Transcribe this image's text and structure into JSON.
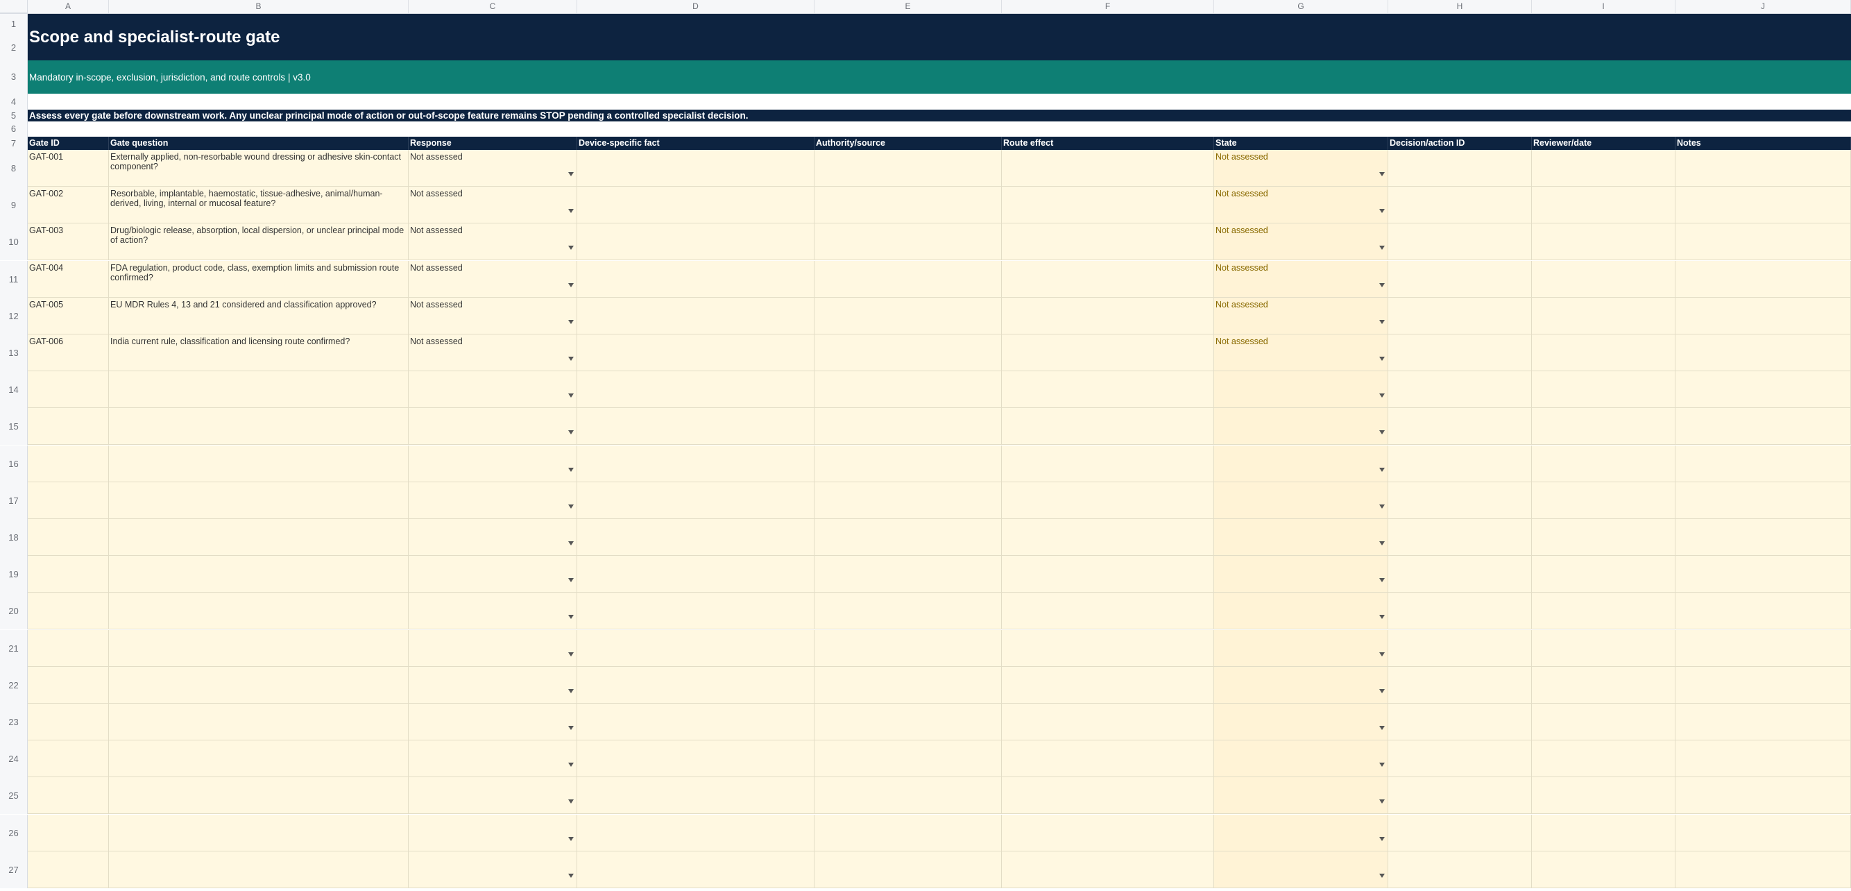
{
  "columns": [
    "A",
    "B",
    "C",
    "D",
    "E",
    "F",
    "G",
    "H",
    "I",
    "J"
  ],
  "row_numbers": [
    "1",
    "2",
    "3",
    "4",
    "5",
    "6",
    "7",
    "8",
    "9",
    "10",
    "11",
    "12",
    "13",
    "14",
    "15",
    "16",
    "17",
    "18",
    "19",
    "20",
    "21",
    "22",
    "23",
    "24",
    "25",
    "26",
    "27"
  ],
  "title": "Scope and specialist-route gate",
  "subtitle": "Mandatory in-scope, exclusion, jurisdiction, and route controls | v3.0",
  "instruction": "Assess every gate before downstream work. Any unclear principal mode of action or out-of-scope feature remains STOP pending a controlled specialist decision.",
  "headers": [
    "Gate ID",
    "Gate question",
    "Response",
    "Device-specific fact",
    "Authority/source",
    "Route effect",
    "State",
    "Decision/action ID",
    "Reviewer/date",
    "Notes"
  ],
  "rows": [
    {
      "id": "GAT-001",
      "question": "Externally applied, non-resorbable wound dressing or adhesive skin-contact component?",
      "response": "Not assessed",
      "state": "Not assessed"
    },
    {
      "id": "GAT-002",
      "question": "Resorbable, implantable, haemostatic, tissue-adhesive, animal/human-derived, living, internal or mucosal feature?",
      "response": "Not assessed",
      "state": "Not assessed"
    },
    {
      "id": "GAT-003",
      "question": "Drug/biologic release, absorption, local dispersion, or unclear principal mode of action?",
      "response": "Not assessed",
      "state": "Not assessed"
    },
    {
      "id": "GAT-004",
      "question": "FDA regulation, product code, class, exemption limits and submission route confirmed?",
      "response": "Not assessed",
      "state": "Not assessed"
    },
    {
      "id": "GAT-005",
      "question": "EU MDR Rules 4, 13 and 21 considered and classification approved?",
      "response": "Not assessed",
      "state": "Not assessed"
    },
    {
      "id": "GAT-006",
      "question": "India current rule, classification and licensing route confirmed?",
      "response": "Not assessed",
      "state": "Not assessed"
    },
    {
      "id": "",
      "question": "",
      "response": "",
      "state": ""
    },
    {
      "id": "",
      "question": "",
      "response": "",
      "state": ""
    },
    {
      "id": "",
      "question": "",
      "response": "",
      "state": ""
    },
    {
      "id": "",
      "question": "",
      "response": "",
      "state": ""
    },
    {
      "id": "",
      "question": "",
      "response": "",
      "state": ""
    },
    {
      "id": "",
      "question": "",
      "response": "",
      "state": ""
    },
    {
      "id": "",
      "question": "",
      "response": "",
      "state": ""
    },
    {
      "id": "",
      "question": "",
      "response": "",
      "state": ""
    },
    {
      "id": "",
      "question": "",
      "response": "",
      "state": ""
    },
    {
      "id": "",
      "question": "",
      "response": "",
      "state": ""
    },
    {
      "id": "",
      "question": "",
      "response": "",
      "state": ""
    },
    {
      "id": "",
      "question": "",
      "response": "",
      "state": ""
    },
    {
      "id": "",
      "question": "",
      "response": "",
      "state": ""
    },
    {
      "id": "",
      "question": "",
      "response": "",
      "state": ""
    }
  ],
  "colors": {
    "navy": "#0d2340",
    "teal": "#0e7f74",
    "input_fill": "#fff8e1"
  }
}
